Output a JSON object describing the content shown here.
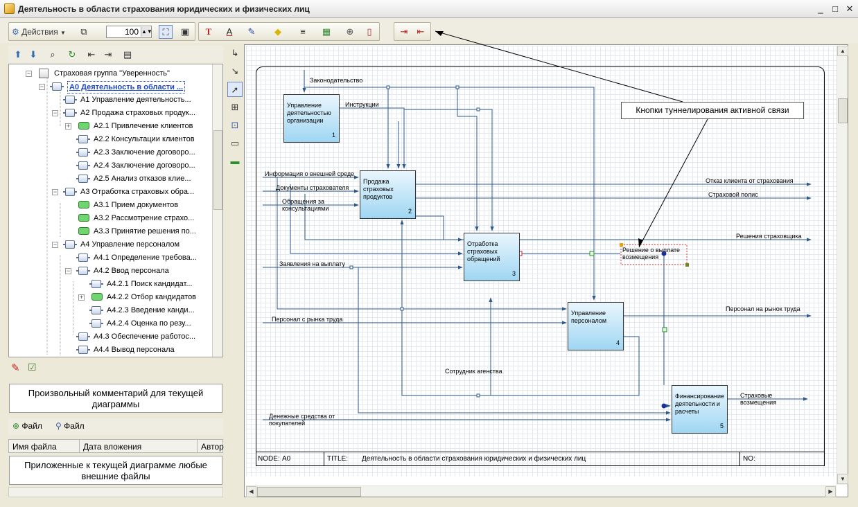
{
  "window": {
    "title": "Деятельность в области страхования юридических и физических лиц",
    "buttons": [
      "_",
      "□",
      "✕"
    ]
  },
  "toolbar": {
    "actions_label": "Действия",
    "zoom_value": "100"
  },
  "tree": {
    "items": [
      {
        "label": "Страховая группа \"Уверенность\"",
        "icon": "group-icon",
        "expander": "−"
      },
      {
        "label": "A0 Деятельность в области ...",
        "icon": "activity-icon",
        "expander": "−",
        "selected": true
      },
      {
        "label": "A1 Управление деятельность...",
        "icon": "activity-icon",
        "expander": ""
      },
      {
        "label": "A2 Продажа страховых продук...",
        "icon": "activity-icon",
        "expander": "−"
      },
      {
        "label": "A2.1 Привлечение клиентов",
        "icon": "leaf-icon",
        "expander": "+"
      },
      {
        "label": "A2.2 Консультации клиентов",
        "icon": "activity-icon",
        "expander": ""
      },
      {
        "label": "A2.3 Заключение договоро...",
        "icon": "activity-icon",
        "expander": ""
      },
      {
        "label": "A2.4 Заключение договоро...",
        "icon": "activity-icon",
        "expander": ""
      },
      {
        "label": "A2.5 Анализ отказов клие...",
        "icon": "activity-icon",
        "expander": ""
      },
      {
        "label": "A3 Отработка страховых обра...",
        "icon": "activity-icon",
        "expander": "−"
      },
      {
        "label": "A3.1 Прием документов",
        "icon": "leaf-icon",
        "expander": ""
      },
      {
        "label": "A3.2 Рассмотрение страхо...",
        "icon": "leaf-icon",
        "expander": ""
      },
      {
        "label": "A3.3 Принятие решения по...",
        "icon": "leaf-icon",
        "expander": ""
      },
      {
        "label": "A4 Управление персоналом",
        "icon": "activity-icon",
        "expander": "−"
      },
      {
        "label": "A4.1 Определение требова...",
        "icon": "activity-icon",
        "expander": ""
      },
      {
        "label": "A4.2 Ввод персонала",
        "icon": "activity-icon",
        "expander": "−"
      },
      {
        "label": "A4.2.1 Поиск кандидат...",
        "icon": "activity-icon",
        "expander": ""
      },
      {
        "label": "A4.2.2 Отбор кандидатов",
        "icon": "leaf-icon",
        "expander": "+"
      },
      {
        "label": "A4.2.3 Введение канди...",
        "icon": "activity-icon",
        "expander": ""
      },
      {
        "label": "A4.2.4 Оценка по резу...",
        "icon": "activity-icon",
        "expander": ""
      },
      {
        "label": "A4.3 Обеспечение работос...",
        "icon": "activity-icon",
        "expander": ""
      },
      {
        "label": "A4.4 Вывод персонала",
        "icon": "activity-icon",
        "expander": ""
      }
    ]
  },
  "comment_panel": {
    "text": "Произвольный комментарий для текущей диаграммы"
  },
  "attachments": {
    "add_label": "Файл",
    "search_label": "Файл",
    "columns": [
      "Имя файла",
      "Дата вложения",
      "Автор"
    ],
    "placeholder": "Приложенные к текущей диаграмме любые внешние файлы"
  },
  "diagram": {
    "callout": "Кнопки туннелирования активной связи",
    "boxes": [
      {
        "text": "Управление деятельностью организации",
        "num": "1"
      },
      {
        "text": "Продажа страховых продуктов",
        "num": "2"
      },
      {
        "text": "Отработка страховых обращений",
        "num": "3"
      },
      {
        "text": "Управление персоналом",
        "num": "4"
      },
      {
        "text": "Финансирование деятельности и расчеты",
        "num": "5"
      }
    ],
    "arrows": {
      "law": "Законодательство",
      "instructions": "Инструкции",
      "info": "Информация о внешней среде",
      "docs": "Документы страхователя",
      "consult": "Обращения за консультациями",
      "claims": "Заявления на выплату",
      "staff_in": "Персонал с рынка труда",
      "money_in": "Денежные средства от покупателей",
      "refusal": "Отказ клиента от страхования",
      "policy": "Страховой полис",
      "decisions": "Решения страховщика",
      "payout": "Решение о выплате возмещения",
      "staff_out": "Персонал на рынок труда",
      "agent": "Сотрудник агенства",
      "compensation": "Страховые возмещения"
    },
    "footer": {
      "node_label": "NODE:",
      "node_value": "A0",
      "title_label": "TITLE:",
      "title_value": "Деятельность в области страхования юридических и физических лиц",
      "no_label": "NO:"
    }
  }
}
